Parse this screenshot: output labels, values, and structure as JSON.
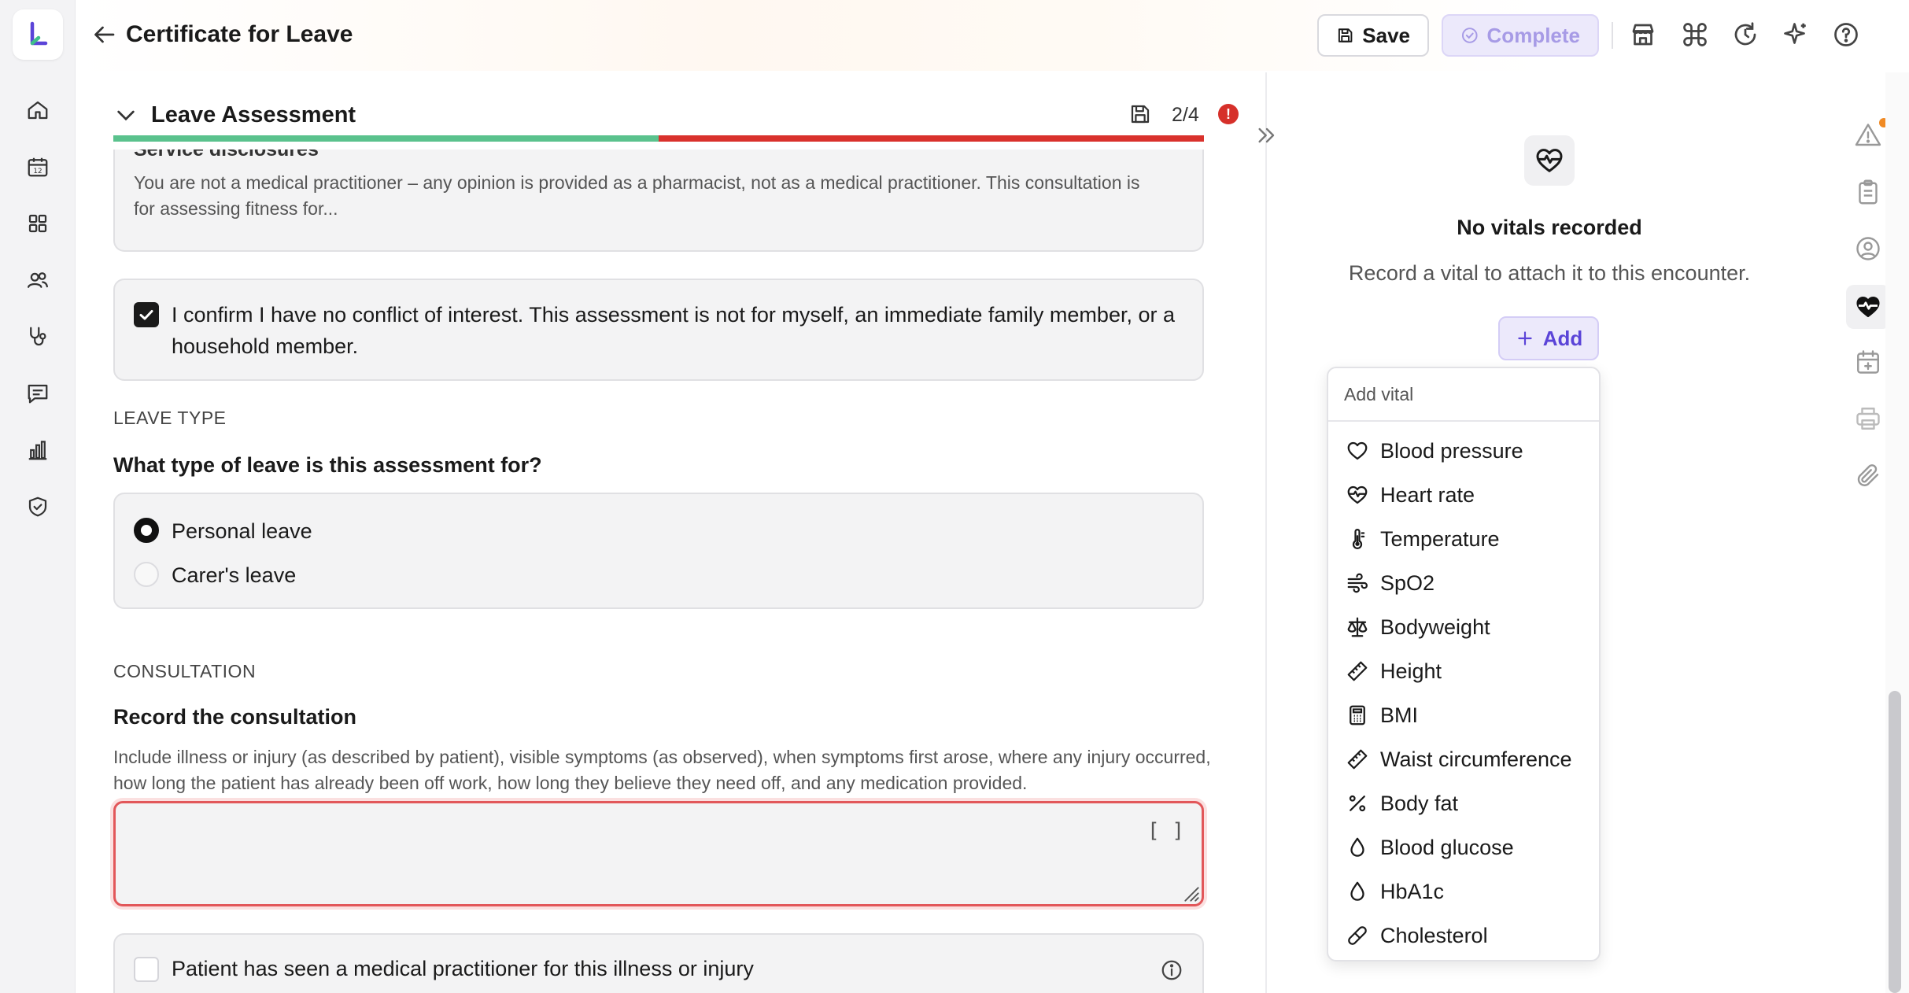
{
  "header": {
    "title": "Certificate for Leave",
    "save_label": "Save",
    "complete_label": "Complete"
  },
  "section": {
    "title": "Leave Assessment",
    "step": "2/4",
    "error_badge": "!",
    "progress_fraction": 0.5
  },
  "disclosure": {
    "heading": "Service disclosures",
    "text": "You are not a medical practitioner – any opinion is provided as a pharmacist, not as a medical practitioner. This consultation is for assessing fitness for..."
  },
  "confirm": {
    "checked": true,
    "text": "I confirm I have no conflict of interest. This assessment is not for myself, an immediate family member, or a household member."
  },
  "leave_type": {
    "overline": "LEAVE TYPE",
    "question": "What type of leave is this assessment for?",
    "options": [
      {
        "label": "Personal leave",
        "selected": true
      },
      {
        "label": "Carer's leave",
        "selected": false
      }
    ]
  },
  "consultation": {
    "overline": "CONSULTATION",
    "question": "Record the consultation",
    "help": "Include illness or injury (as described by patient), visible symptoms (as observed), when symptoms first arose, where any injury occurred, how long the patient has already been off work, how long they believe they need off, and any medication provided.",
    "value": "",
    "expand_glyph": "[ ]"
  },
  "seen_practitioner": {
    "checked": false,
    "label": "Patient has seen a medical practitioner for this illness or injury"
  },
  "vitals": {
    "empty_title": "No vitals recorded",
    "empty_subtitle": "Record a vital to attach it to this encounter.",
    "add_label": "Add",
    "menu_heading": "Add vital",
    "menu_items": [
      {
        "label": "Blood pressure",
        "icon": "heart-icon"
      },
      {
        "label": "Heart rate",
        "icon": "heart-pulse-icon"
      },
      {
        "label": "Temperature",
        "icon": "thermometer-icon"
      },
      {
        "label": "SpO2",
        "icon": "wind-icon"
      },
      {
        "label": "Bodyweight",
        "icon": "scale-icon"
      },
      {
        "label": "Height",
        "icon": "ruler-icon"
      },
      {
        "label": "BMI",
        "icon": "calculator-icon"
      },
      {
        "label": "Waist circumference",
        "icon": "ruler-icon"
      },
      {
        "label": "Body fat",
        "icon": "percent-icon"
      },
      {
        "label": "Blood glucose",
        "icon": "droplet-icon"
      },
      {
        "label": "HbA1c",
        "icon": "droplet-icon"
      },
      {
        "label": "Cholesterol",
        "icon": "pill-icon"
      }
    ]
  },
  "colors": {
    "accent": "#5b44d8",
    "progress_done": "#5ac28d",
    "progress_todo": "#d9312c",
    "error": "#d6302a",
    "notification": "#f08a24"
  }
}
